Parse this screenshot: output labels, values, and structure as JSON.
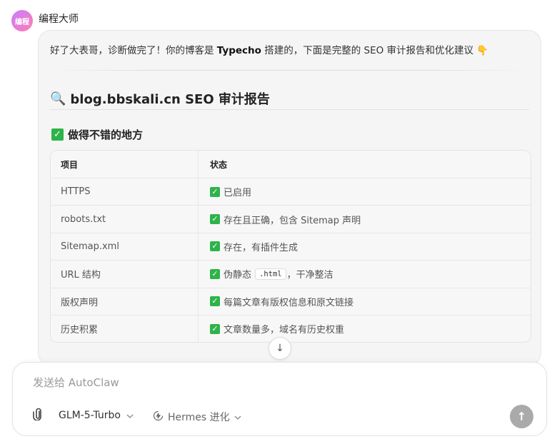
{
  "assistant": {
    "avatar_text": "编程",
    "name": "编程大师"
  },
  "message": {
    "intro_before": "好了大表哥，诊断做完了！你的博客是 ",
    "intro_bold": "Typecho",
    "intro_after": " 搭建的，下面是完整的 SEO 审计报告和优化建议 👇",
    "title": "blog.bbskali.cn SEO 审计报告",
    "title_icon": "🔍",
    "section_title": "做得不错的地方",
    "check_glyph": "✓",
    "table": {
      "headers": [
        "项目",
        "状态"
      ],
      "rows": [
        {
          "item": "HTTPS",
          "status": "已启用"
        },
        {
          "item": "robots.txt",
          "status": "存在且正确，包含 Sitemap 声明"
        },
        {
          "item": "Sitemap.xml",
          "status": "存在，有插件生成"
        },
        {
          "item": "URL 结构",
          "status_before": "伪静态",
          "status_code": ".html",
          "status_after": "，干净整洁"
        },
        {
          "item": "版权声明",
          "status": "每篇文章有版权信息和原文链接"
        },
        {
          "item": "历史积累",
          "status": "文章数量多，域名有历史权重"
        }
      ]
    }
  },
  "scroll_icon": "↓",
  "composer": {
    "placeholder": "发送给 AutoClaw",
    "attach_icon": "paperclip-icon",
    "model": "GLM-5-Turbo",
    "mode": "Hermes 进化",
    "send_icon": "↑"
  },
  "colors": {
    "check": "#2db34a",
    "send_disabled": "#aaaaaa"
  }
}
